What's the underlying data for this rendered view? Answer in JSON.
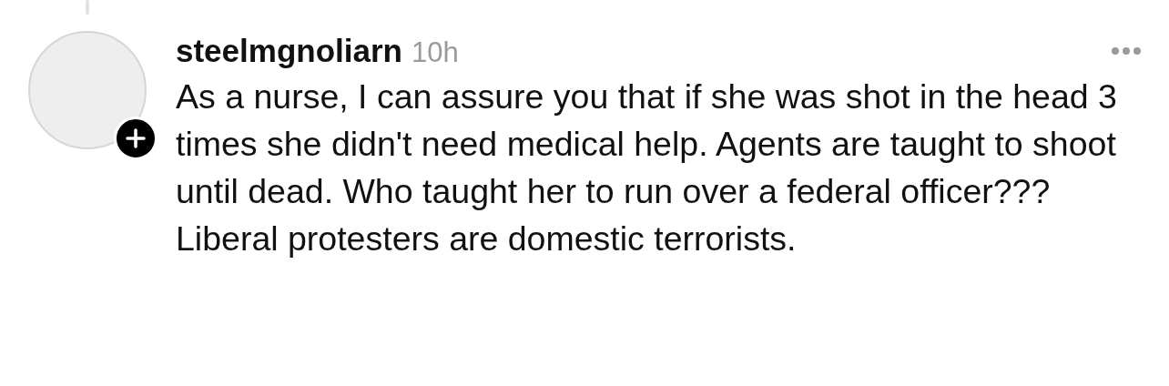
{
  "comment": {
    "username": "steelmgnoliarn",
    "time": "10h",
    "body": "As a nurse, I can assure you that if she was shot in the head 3 times she didn't need medical help. Agents are taught to shoot until dead. Who taught her to run over a federal officer??? Liberal protesters are domestic terrorists."
  }
}
